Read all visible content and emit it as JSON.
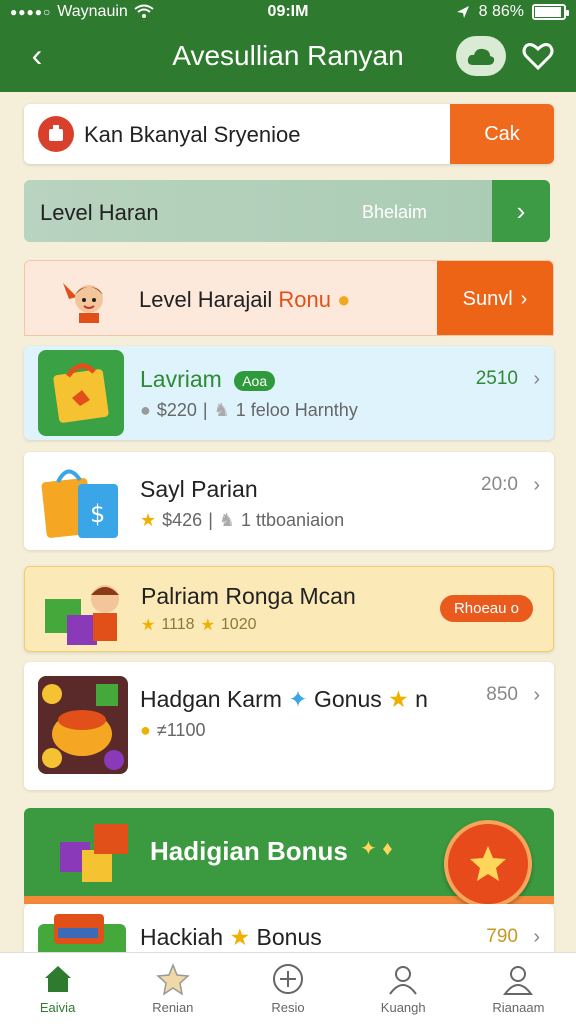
{
  "status_bar": {
    "carrier": "Waynauin",
    "time": "09:IM",
    "battery": "8 86%",
    "battery_level": 0.86
  },
  "header": {
    "back_label": "‹",
    "title": "Avesullian Ranyan"
  },
  "search": {
    "text": "Kan Bkanyal Sryenioe",
    "button_label": "Cak"
  },
  "level_bar": {
    "label": "Level Haran",
    "status": "Bhelaim",
    "chevron": "›"
  },
  "promo": {
    "label_main": "Level Harajail",
    "label_highlight": "Ronu",
    "button_label": "Sunvl",
    "chevron": "›"
  },
  "cards": [
    {
      "title": "Lavriam",
      "pill": "Aoa",
      "sub1": "$220",
      "sub2": "1 feloo Harnthy",
      "value": "2510"
    },
    {
      "title": "Sayl Parian",
      "sub1": "$426",
      "sub2": "1 ttboaniaion",
      "value": "20:0"
    },
    {
      "title": "Palriam Ronga Mcan",
      "sub1": "1118",
      "sub2": "1020",
      "pill": "Rhoeau o"
    },
    {
      "title": "Hadgan Karm",
      "title_suffix": "Gonus",
      "title_trailing": "n",
      "sub1": "≠1100",
      "value": "850"
    }
  ],
  "banner": {
    "label": "Hadigian Bonus"
  },
  "card5": {
    "title": "Hackiah",
    "title_suffix": "Bonus",
    "value": "790"
  },
  "tabbar": {
    "items": [
      {
        "label": "Eaivia",
        "icon": "home-icon"
      },
      {
        "label": "Renian",
        "icon": "star-icon"
      },
      {
        "label": "Resio",
        "icon": "target-icon"
      },
      {
        "label": "Kuangh",
        "icon": "user-icon"
      },
      {
        "label": "Rianaam",
        "icon": "profile-icon"
      }
    ]
  },
  "colors": {
    "header_green": "#2e7a2e",
    "accent_orange": "#ef6a1c",
    "banner_green": "#3b9a3f"
  }
}
